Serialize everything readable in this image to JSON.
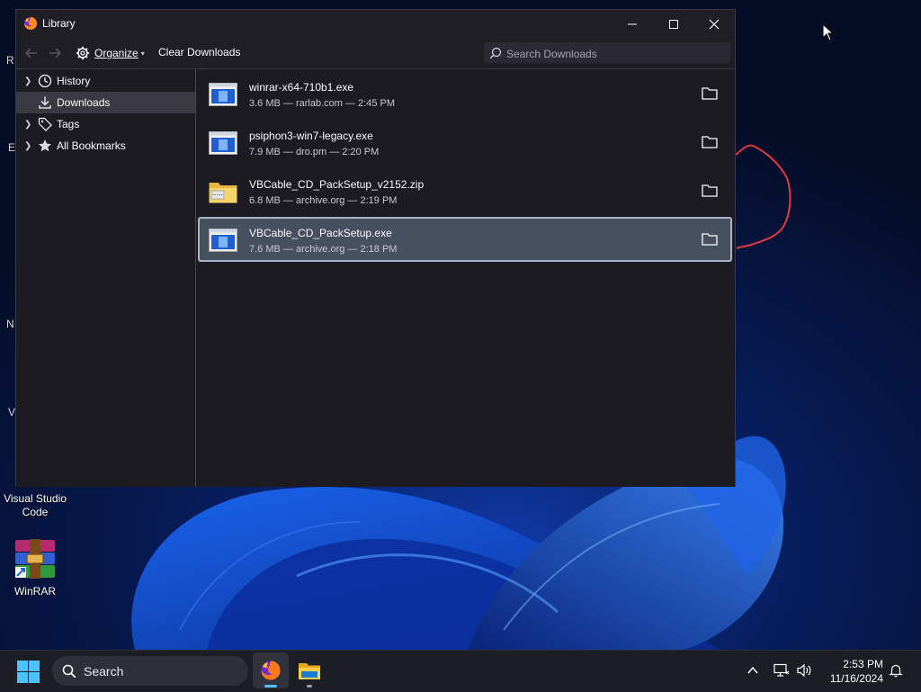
{
  "colors": {
    "window_bg": "#1c1b22",
    "toolbar_bg": "#1f1e25",
    "selected_row": "#47505f",
    "accent": "#4cc2ff",
    "scribble": "#e03a44"
  },
  "desktop": {
    "icons": [
      {
        "label": "Visual Studio Code",
        "icon": "vscode-icon"
      },
      {
        "label": "WinRAR",
        "icon": "winrar-icon"
      }
    ],
    "edge_letters": [
      "R",
      "E",
      "N",
      "V"
    ]
  },
  "window": {
    "title": "Library",
    "controls": {
      "minimize": "minimize-icon",
      "maximize": "maximize-icon",
      "close": "close-icon"
    }
  },
  "toolbar": {
    "organize_label": "Organize",
    "clear_label": "Clear Downloads",
    "search_placeholder": "Search Downloads"
  },
  "sidebar": {
    "items": [
      {
        "label": "History",
        "icon": "clock-icon",
        "expandable": true,
        "selected": false
      },
      {
        "label": "Downloads",
        "icon": "download-icon",
        "expandable": false,
        "selected": true
      },
      {
        "label": "Tags",
        "icon": "tag-icon",
        "expandable": true,
        "selected": false
      },
      {
        "label": "All Bookmarks",
        "icon": "star-icon",
        "expandable": true,
        "selected": false
      }
    ]
  },
  "downloads": [
    {
      "name": "winrar-x64-710b1.exe",
      "meta": "3.6 MB — rarlab.com — 2:45 PM",
      "type": "exe",
      "selected": false
    },
    {
      "name": "psiphon3-win7-legacy.exe",
      "meta": "7.9 MB — dro.pm — 2:20 PM",
      "type": "exe",
      "selected": false
    },
    {
      "name": "VBCable_CD_PackSetup_v2152.zip",
      "meta": "6.8 MB — archive.org — 2:19 PM",
      "type": "zip",
      "selected": false
    },
    {
      "name": "VBCable_CD_PackSetup.exe",
      "meta": "7.6 MB — archive.org — 2:18 PM",
      "type": "exe",
      "selected": true
    }
  ],
  "taskbar": {
    "search_label": "Search",
    "apps": [
      {
        "name": "Firefox",
        "icon": "firefox-icon",
        "active": true
      },
      {
        "name": "File Explorer",
        "icon": "folder-icon",
        "active": false
      }
    ],
    "clock": {
      "time": "2:53 PM",
      "date": "11/16/2024"
    }
  }
}
